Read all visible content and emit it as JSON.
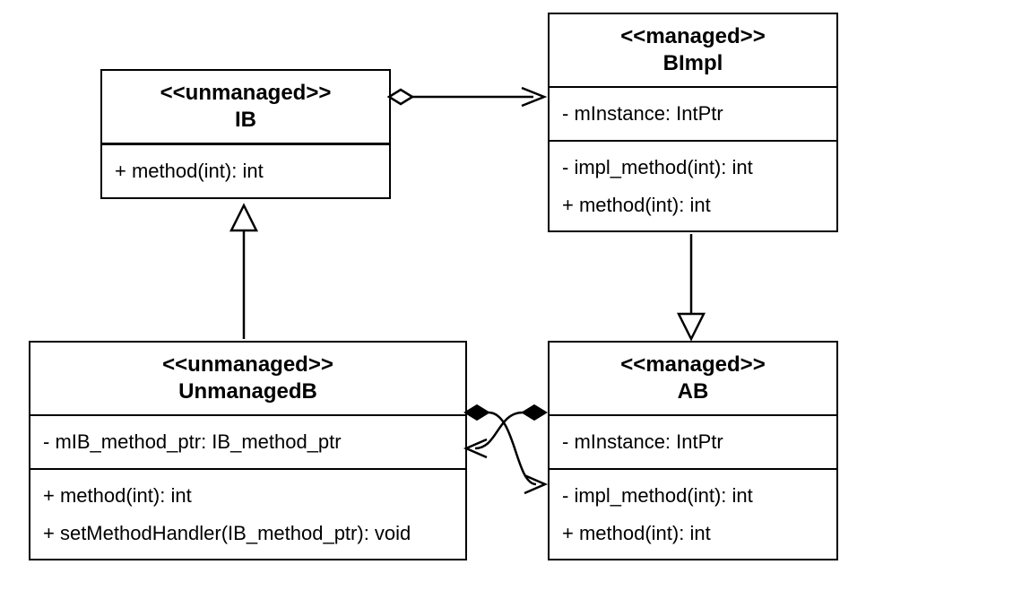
{
  "classes": {
    "ib": {
      "stereotype": "<<unmanaged>>",
      "name": "IB",
      "methods": [
        "+ method(int): int"
      ]
    },
    "bimpl": {
      "stereotype": "<<managed>>",
      "name": "BImpl",
      "attributes": [
        "- mInstance: IntPtr"
      ],
      "methods": [
        "- impl_method(int): int",
        "+ method(int): int"
      ]
    },
    "unmanagedb": {
      "stereotype": "<<unmanaged>>",
      "name": "UnmanagedB",
      "attributes": [
        "- mIB_method_ptr: IB_method_ptr"
      ],
      "methods": [
        "+ method(int): int",
        "+ setMethodHandler(IB_method_ptr): void"
      ]
    },
    "ab": {
      "stereotype": "<<managed>>",
      "name": "AB",
      "attributes": [
        "- mInstance: IntPtr"
      ],
      "methods": [
        "- impl_method(int): int",
        "+ method(int): int"
      ]
    }
  },
  "relationships": [
    {
      "from": "IB",
      "to": "BImpl",
      "type": "aggregation"
    },
    {
      "from": "UnmanagedB",
      "to": "IB",
      "type": "generalization"
    },
    {
      "from": "BImpl",
      "to": "AB",
      "type": "generalization"
    },
    {
      "from": "UnmanagedB",
      "to": "AB",
      "type": "composition-bidirectional"
    }
  ]
}
